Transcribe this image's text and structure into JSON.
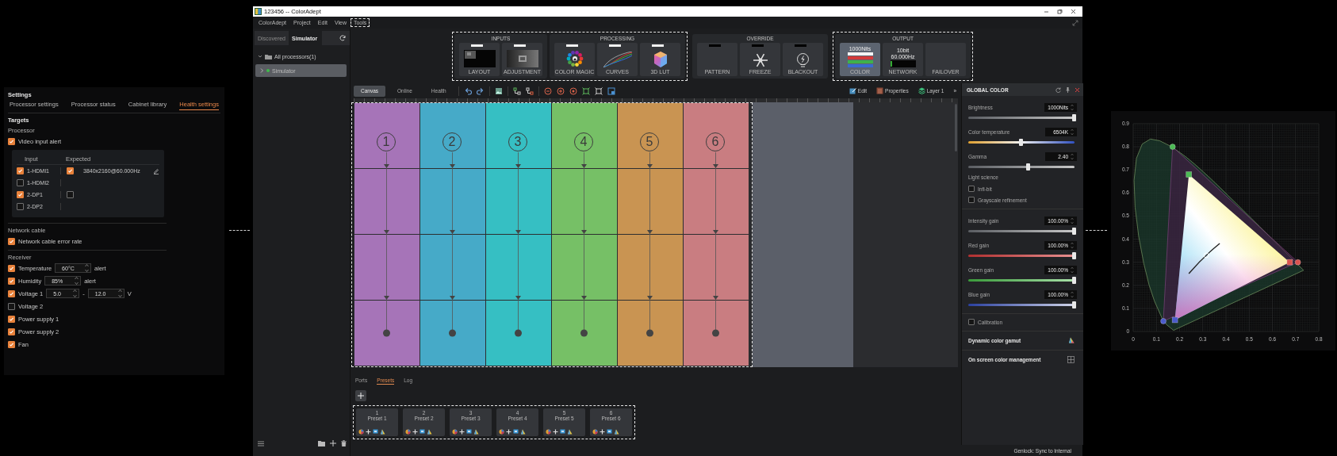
{
  "settings_panel": {
    "title": "Settings",
    "tabs": [
      {
        "label": "Processor settings",
        "selected": false
      },
      {
        "label": "Processor status",
        "selected": false
      },
      {
        "label": "Cabinet library",
        "selected": false
      },
      {
        "label": "Health settings",
        "selected": true
      }
    ],
    "heading": "Targets",
    "processor": {
      "label": "Processor",
      "alert": {
        "label": "Video input alert",
        "checked": true
      },
      "table": {
        "columns": [
          "Input",
          "Expected"
        ],
        "rows": [
          {
            "input": "1-HDMI1",
            "checked": true,
            "expected_checked": true,
            "expected": "3840x2160@60.000Hz"
          },
          {
            "input": "1-HDMI2",
            "checked": false
          },
          {
            "input": "2-DP1",
            "checked": true,
            "expected_checked": false
          },
          {
            "input": "2-DP2",
            "checked": false
          }
        ]
      }
    },
    "network": {
      "label": "Network cable",
      "items": [
        {
          "label": "Network cable error rate",
          "checked": true
        }
      ]
    },
    "receiver": {
      "label": "Receiver",
      "items": [
        {
          "kind": "threshold",
          "label": "Temperature",
          "checked": true,
          "value": "60°C",
          "suffix": "alert"
        },
        {
          "kind": "threshold",
          "label": "Humidity",
          "checked": true,
          "value": "85%",
          "suffix": "alert"
        },
        {
          "kind": "range",
          "label": "Voltage 1",
          "checked": true,
          "min": "5.0",
          "separator": "-",
          "max": "12.0",
          "unit": "V"
        },
        {
          "kind": "check",
          "label": "Voltage 2",
          "checked": false
        },
        {
          "kind": "check",
          "label": "Power supply 1",
          "checked": true
        },
        {
          "kind": "check",
          "label": "Power supply 2",
          "checked": true
        },
        {
          "kind": "check",
          "label": "Fan",
          "checked": true
        }
      ]
    }
  },
  "window": {
    "title": "123456 -- ColorAdept"
  },
  "menu": [
    {
      "label": "ColorAdept",
      "highlighted": false
    },
    {
      "label": "Project",
      "highlighted": false
    },
    {
      "label": "Edit",
      "highlighted": false
    },
    {
      "label": "View",
      "highlighted": false
    },
    {
      "label": "Tools",
      "highlighted": true
    }
  ],
  "sidebar": {
    "tabs": [
      {
        "label": "Discovered",
        "selected": false
      },
      {
        "label": "Simulator",
        "selected": true
      }
    ],
    "tree": [
      {
        "label": "All processors(1)",
        "expanded": true,
        "children": [
          {
            "label": "Simulator",
            "selected": true,
            "color": "#3dbb4a"
          }
        ]
      }
    ]
  },
  "ribbon": {
    "sections": [
      {
        "highlighted": true,
        "groups": [
          {
            "title": "INPUTS",
            "tiles": [
              {
                "label": "LAYOUT",
                "kind": "layout",
                "active": true
              },
              {
                "label": "ADJUSTMENT",
                "kind": "adjustment",
                "active": true
              }
            ]
          },
          {
            "title": "PROCESSING",
            "tiles": [
              {
                "label": "COLOR MAGIC",
                "kind": "color_magic",
                "active": true
              },
              {
                "label": "CURVES",
                "kind": "curves",
                "active": true
              },
              {
                "label": "3D LUT",
                "kind": "lut",
                "active": true
              }
            ]
          }
        ]
      },
      {
        "highlighted": false,
        "groups": [
          {
            "title": "OVERRIDE",
            "tiles": [
              {
                "label": "PATTERN",
                "kind": "pattern",
                "active": false
              },
              {
                "label": "FREEZE",
                "kind": "freeze",
                "active": false
              },
              {
                "label": "BLACKOUT",
                "kind": "blackout",
                "active": false
              }
            ]
          }
        ]
      },
      {
        "highlighted": true,
        "groups": [
          {
            "title": "OUTPUT",
            "tiles": [
              {
                "label": "COLOR",
                "kind": "color",
                "selected": true,
                "readout": [
                  "1000Nits"
                ]
              },
              {
                "label": "NETWORK",
                "kind": "network",
                "selected": false,
                "readout": [
                  "10bit",
                  "60.000Hz"
                ]
              },
              {
                "label": "FAILOVER",
                "kind": "failover",
                "selected": false
              }
            ]
          }
        ]
      }
    ]
  },
  "view_tabs": [
    {
      "label": "Canvas",
      "selected": true
    },
    {
      "label": "Online",
      "selected": false
    },
    {
      "label": "Health",
      "selected": false
    }
  ],
  "view_actions": [
    {
      "label": "Edit",
      "kind": "edit"
    },
    {
      "label": "Properties",
      "kind": "properties"
    },
    {
      "label": "Layer 1",
      "kind": "layer"
    },
    {
      "label": "»",
      "kind": "more"
    }
  ],
  "canvas": {
    "highlighted": true,
    "columns": [
      {
        "label": "1",
        "color": "#a674b8"
      },
      {
        "label": "2",
        "color": "#46aac8"
      },
      {
        "label": "3",
        "color": "#36bfc3"
      },
      {
        "label": "4",
        "color": "#76c066"
      },
      {
        "label": "5",
        "color": "#c99452"
      },
      {
        "label": "6",
        "color": "#c97d81"
      }
    ]
  },
  "bottom_tabs": [
    {
      "label": "Ports",
      "selected": false
    },
    {
      "label": "Presets",
      "selected": true
    },
    {
      "label": "Log",
      "selected": false
    }
  ],
  "presets": {
    "highlighted": true,
    "items": [
      {
        "number": "1",
        "name": "Preset 1"
      },
      {
        "number": "2",
        "name": "Preset 2"
      },
      {
        "number": "3",
        "name": "Preset 3"
      },
      {
        "number": "4",
        "name": "Preset 4"
      },
      {
        "number": "5",
        "name": "Preset 5"
      },
      {
        "number": "6",
        "name": "Preset 6"
      }
    ]
  },
  "global_color": {
    "title": "GLOBAL COLOR",
    "sections": [
      [
        {
          "kind": "neutral",
          "label": "Brightness",
          "value": "1000Nits",
          "level": 1
        },
        {
          "kind": "temperature",
          "label": "Color temperature",
          "value": "6504K",
          "level": 0.5
        },
        {
          "kind": "neutral",
          "label": "Gamma",
          "value": "2.40",
          "level": 0.57
        },
        {
          "kind": "heading",
          "label": "Light science"
        },
        {
          "kind": "checkbox",
          "label": "Infi-bit",
          "checked": false
        },
        {
          "kind": "checkbox",
          "label": "Grayscale refinement",
          "checked": false
        }
      ],
      [
        {
          "kind": "neutral",
          "label": "Intensity gain",
          "value": "100.00%",
          "level": 1
        },
        {
          "kind": "red",
          "label": "Red gain",
          "value": "100.00%",
          "level": 1
        },
        {
          "kind": "green",
          "label": "Green gain",
          "value": "100.00%",
          "level": 1
        },
        {
          "kind": "blue",
          "label": "Blue gain",
          "value": "100.00%",
          "level": 1
        }
      ],
      [
        {
          "kind": "checkbox",
          "label": "Calibration",
          "checked": false
        }
      ],
      [
        {
          "kind": "action",
          "label": "Dynamic color gamut"
        }
      ],
      [
        {
          "kind": "action",
          "label": "On screen color management"
        }
      ]
    ]
  },
  "status_bar": {
    "text": "Genlock: Sync to Internal"
  },
  "gamut_chart": {
    "x_labels": [
      "0",
      "0.1",
      "0.2",
      "0.3",
      "0.4",
      "0.5",
      "0.6",
      "0.7",
      "0.8"
    ],
    "y_labels": [
      "0.9",
      "0.8",
      "0.7",
      "0.6",
      "0.5",
      "0.4",
      "0.3",
      "0.2",
      "0.1",
      "0"
    ]
  }
}
